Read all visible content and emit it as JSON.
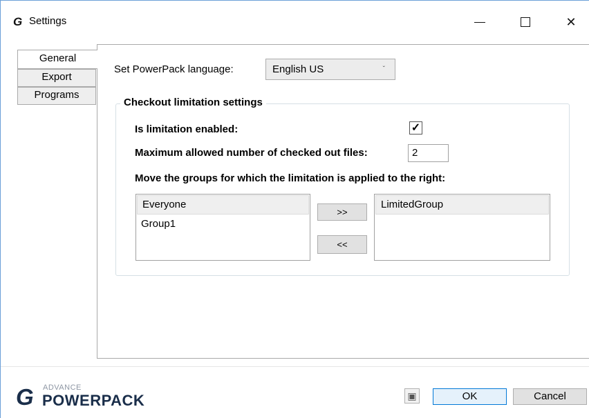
{
  "window": {
    "icon": "G",
    "title": "Settings",
    "controls": {
      "minimize_icon": "minimize-icon",
      "maximize_icon": "maximize-icon",
      "close_glyph": "✕"
    }
  },
  "tabs": [
    {
      "label": "General",
      "active": true
    },
    {
      "label": "Export",
      "active": false
    },
    {
      "label": "Programs",
      "active": false
    }
  ],
  "general": {
    "language_label": "Set PowerPack language:",
    "language_value": "English US",
    "language_chevron": "ˇ",
    "checkout": {
      "title": "Checkout limitation settings",
      "enabled_label": "Is limitation enabled:",
      "enabled_checked": true,
      "check_glyph": "✓",
      "max_label": "Maximum allowed number of checked out files:",
      "max_value": "2",
      "move_label": "Move the groups for which the limitation is applied to the right:",
      "available_groups": [
        "Everyone",
        "Group1"
      ],
      "limited_groups": [
        "LimitedGroup"
      ],
      "move_right_label": ">>",
      "move_left_label": "<<"
    }
  },
  "footer": {
    "logo_mark": "G",
    "logo_top": "ADVANCE",
    "logo_bottom": "POWERPACK",
    "help_glyph": "▣",
    "ok_label": "OK",
    "cancel_label": "Cancel"
  },
  "colors": {
    "accent": "#0078d7",
    "logo": "#1a2e4a",
    "titlebar_border": "#6a9fd8"
  }
}
